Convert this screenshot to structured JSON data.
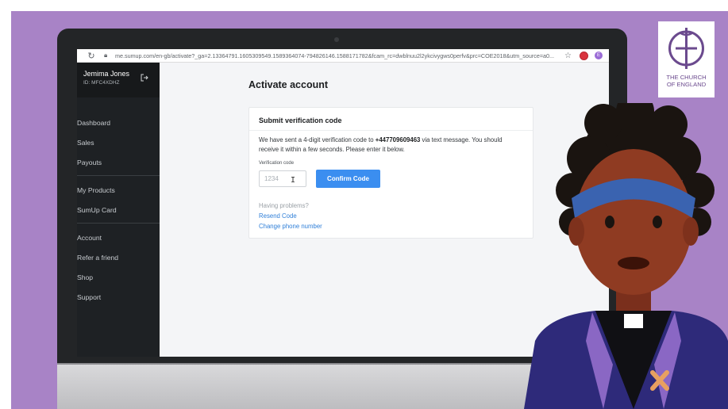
{
  "browser": {
    "url": "me.sumup.com/en-gb/activate?_ga=2.13364791.1605309549.1589364074-794826146.1588171782&fcam_rc=dwblnuu2l2ykcivygws0perfv&prc=COE2018&utm_source=a0...",
    "reload_icon": "reload-icon",
    "star_icon": "star-icon"
  },
  "sidebar": {
    "user_name": "Jemima Jones",
    "user_id": "ID: MFC4XDHZ",
    "items": [
      {
        "label": "Dashboard"
      },
      {
        "label": "Sales"
      },
      {
        "label": "Payouts"
      },
      {
        "label": "My Products"
      },
      {
        "label": "SumUp Card"
      },
      {
        "label": "Account"
      },
      {
        "label": "Refer a friend"
      },
      {
        "label": "Shop"
      },
      {
        "label": "Support"
      }
    ]
  },
  "main": {
    "title": "Activate account",
    "card": {
      "title": "Submit verification code",
      "message_before": "We have sent a 4-digit verification code to ",
      "phone": "+447709609463",
      "message_after": " via text message. You should receive it within a few seconds. Please enter it below.",
      "field_label": "Verification code",
      "field_placeholder": "1234",
      "confirm_label": "Confirm Code",
      "problems_text": "Having problems?",
      "resend_label": "Resend Code",
      "change_phone_label": "Change phone number"
    }
  },
  "branding": {
    "coe_line1": "THE CHURCH",
    "coe_line2": "OF ENGLAND"
  },
  "colors": {
    "background": "#a883c6",
    "accent_blue": "#3b8ef0",
    "link_blue": "#2f7fd8",
    "sidebar": "#1e2124",
    "brand_purple": "#6b4a8e"
  }
}
